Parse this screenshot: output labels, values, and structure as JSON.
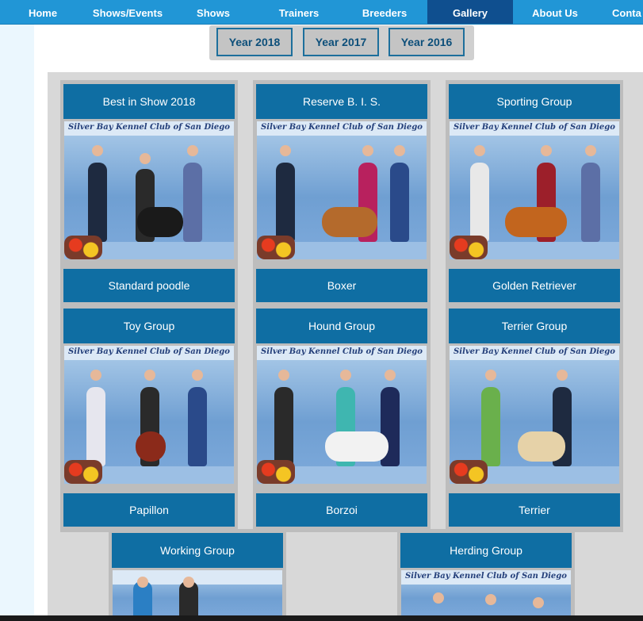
{
  "nav": {
    "items": [
      {
        "label": "Home",
        "active": false
      },
      {
        "label": "Shows/Events",
        "active": false
      },
      {
        "label": "Shows",
        "active": false
      },
      {
        "label": "Trainers",
        "active": false
      },
      {
        "label": "Breeders",
        "active": false
      },
      {
        "label": "Gallery",
        "active": true
      },
      {
        "label": "About Us",
        "active": false
      },
      {
        "label": "Conta",
        "active": false
      }
    ]
  },
  "years": [
    "Year 2018",
    "Year 2017",
    "Year 2016"
  ],
  "banner_text": "Silver Bay Kennel Club of San Diego",
  "cards": [
    {
      "title": "Best in Show 2018",
      "breed": "Standard poodle"
    },
    {
      "title": "Reserve B. I. S.",
      "breed": "Boxer"
    },
    {
      "title": "Sporting Group",
      "breed": "Golden Retriever"
    },
    {
      "title": "Toy Group",
      "breed": "Papillon"
    },
    {
      "title": "Hound Group",
      "breed": "Borzoi"
    },
    {
      "title": "Terrier Group",
      "breed": "Terrier"
    },
    {
      "title": "Working Group",
      "breed": ""
    },
    {
      "title": "Herding Group",
      "breed": ""
    }
  ],
  "colors": {
    "nav_bg": "#2196d6",
    "nav_active": "#0f4f8f",
    "caption_bg": "#0f6ea3"
  }
}
